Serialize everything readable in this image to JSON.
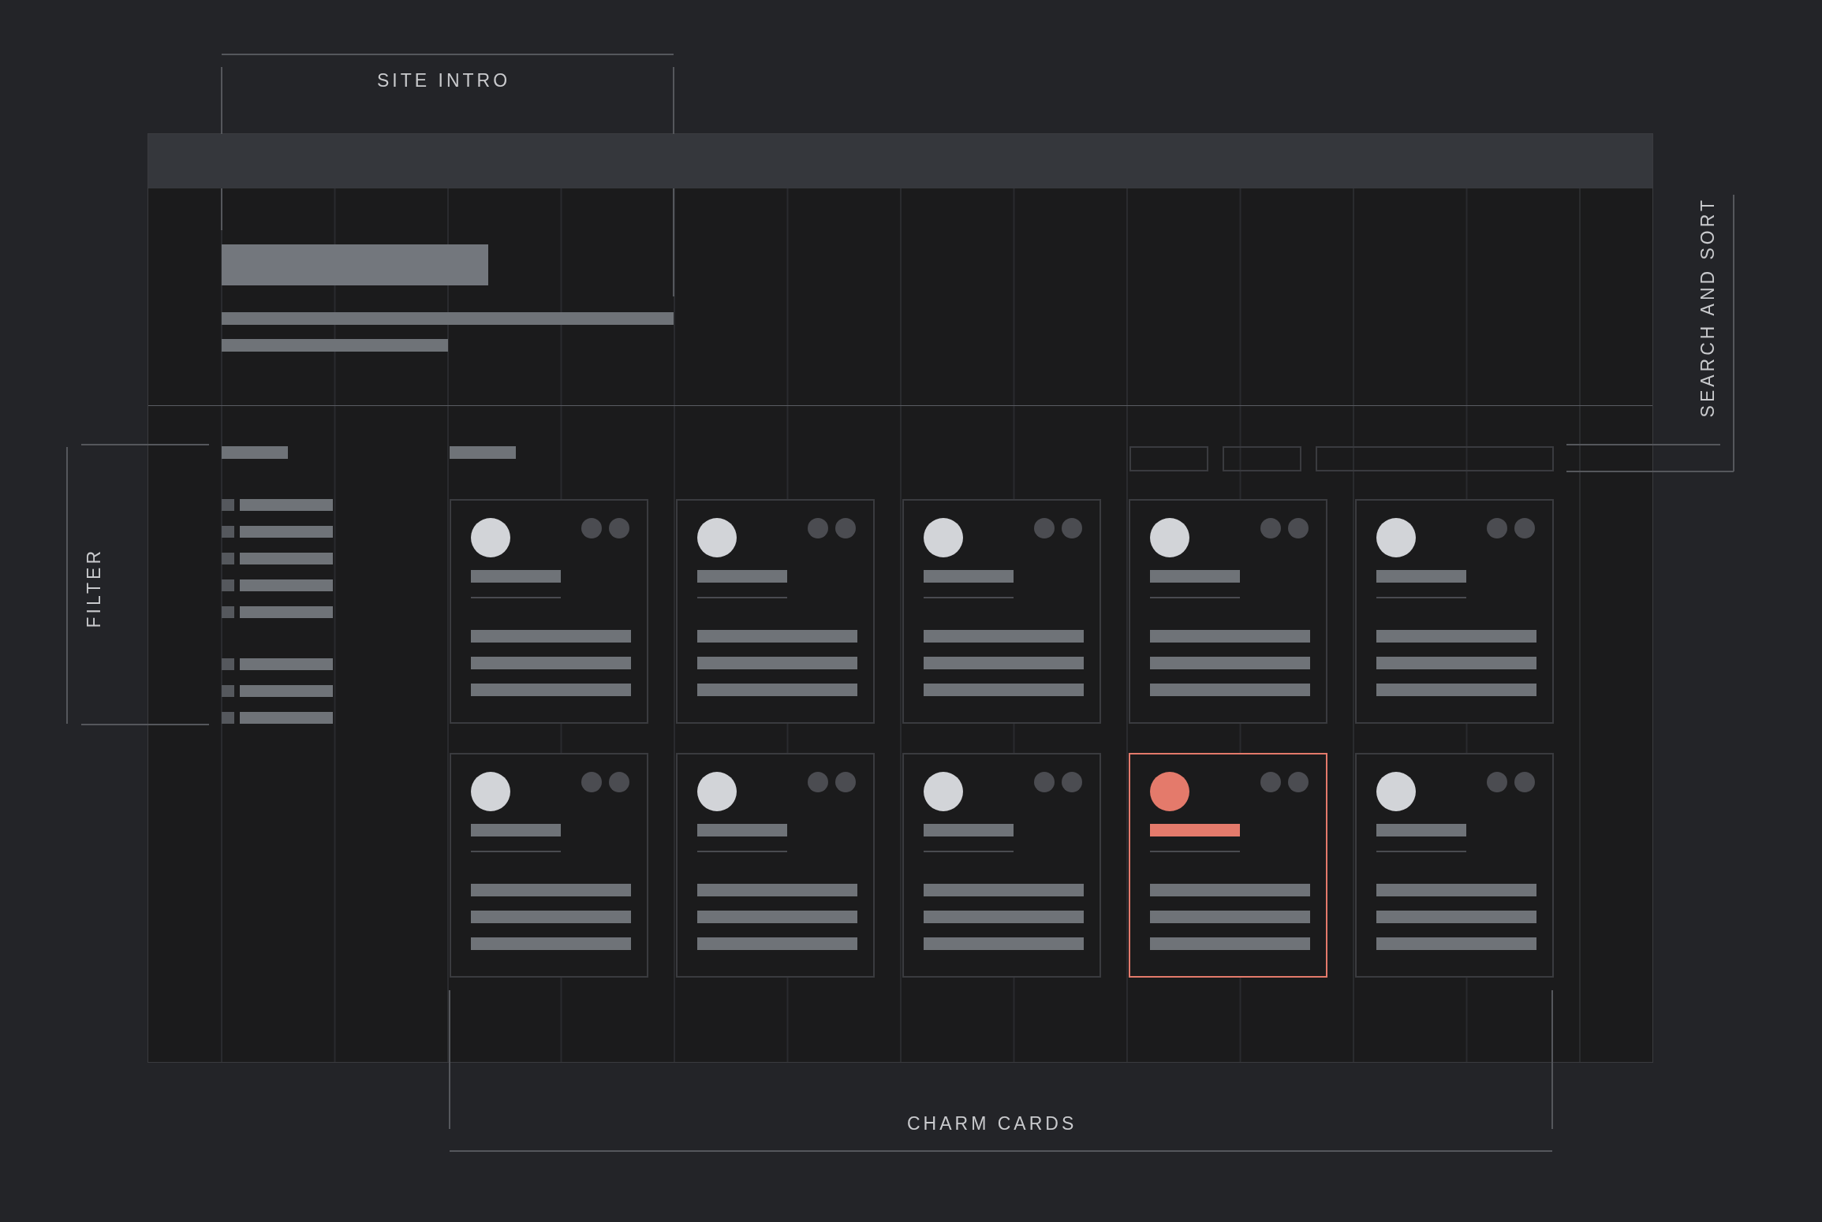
{
  "annotations": [
    {
      "kind": "top",
      "label": "SITE INTRO"
    },
    {
      "kind": "right",
      "label": "SEARCH AND SORT"
    },
    {
      "kind": "left",
      "label": "FILTER"
    },
    {
      "kind": "bottom",
      "label": "CHARM CARDS"
    }
  ],
  "cards": [
    {
      "selected": false
    },
    {
      "selected": false
    },
    {
      "selected": false
    },
    {
      "selected": false
    },
    {
      "selected": false
    },
    {
      "selected": false
    },
    {
      "selected": false
    },
    {
      "selected": false
    },
    {
      "selected": true
    },
    {
      "selected": false
    }
  ]
}
